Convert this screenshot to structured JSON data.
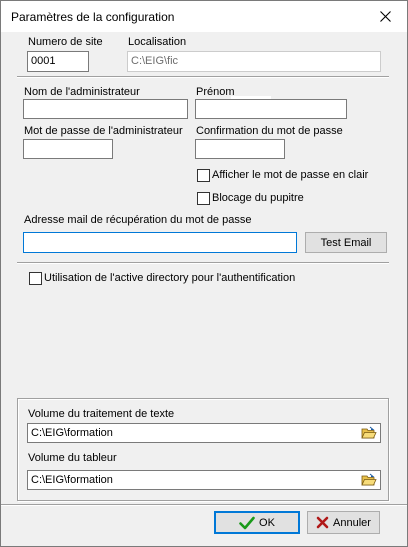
{
  "window": {
    "title": "Paramètres de la configuration"
  },
  "site": {
    "number_label": "Numero de site",
    "number_value": "0001",
    "location_label": "Localisation",
    "location_value": "C:\\EIG\\fic"
  },
  "admin": {
    "name_label": "Nom  de l'administrateur",
    "name_value": "",
    "firstname_label": "Prénom",
    "firstname_value": "",
    "password_label": "Mot de passe de l'administrateur",
    "password_value": "",
    "confirm_label": "Confirmation du mot de passe",
    "confirm_value": "",
    "show_password_label": "Afficher le mot de passe en clair",
    "show_password_checked": false,
    "lock_desk_label": "Blocage du pupitre",
    "lock_desk_checked": false
  },
  "recovery": {
    "email_label": "Adresse mail de récupération du mot de passe",
    "email_value": "",
    "test_button_label": "Test Email"
  },
  "ad": {
    "label": "Utilisation de l'active directory pour l'authentification",
    "checked": false
  },
  "volumes": {
    "text_label": "Volume du traitement de texte",
    "text_value": "C:\\EIG\\formation",
    "spreadsheet_label": "Volume du tableur",
    "spreadsheet_value": "C:\\EIG\\formation"
  },
  "footer": {
    "ok_label": "OK",
    "cancel_label": "Annuler"
  },
  "colors": {
    "accent": "#0078d7",
    "ok_check": "#1a9a1a",
    "cancel_x": "#b01818"
  }
}
